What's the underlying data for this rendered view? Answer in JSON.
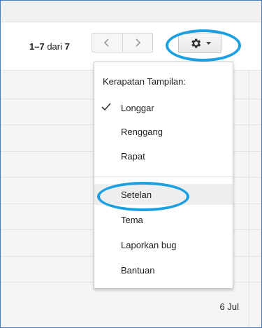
{
  "toolbar": {
    "range": "1–7",
    "range_suffix": "dari",
    "total": "7",
    "prev_icon": "chevron-left",
    "next_icon": "chevron-right",
    "settings_icon": "gear",
    "dropdown_icon": "caret-down"
  },
  "menu": {
    "heading": "Kerapatan Tampilan:",
    "density_options": [
      {
        "label": "Longgar",
        "checked": true
      },
      {
        "label": "Renggang",
        "checked": false
      },
      {
        "label": "Rapat",
        "checked": false
      }
    ],
    "actions": [
      {
        "label": "Setelan",
        "hovered": true
      },
      {
        "label": "Tema"
      },
      {
        "label": "Laporkan bug"
      },
      {
        "label": "Bantuan"
      }
    ]
  },
  "list": {
    "date": "6 Jul"
  },
  "colors": {
    "highlight": "#1ba0e1",
    "frame_border": "#4a7cc0",
    "hover_background": "#eeeeee"
  }
}
